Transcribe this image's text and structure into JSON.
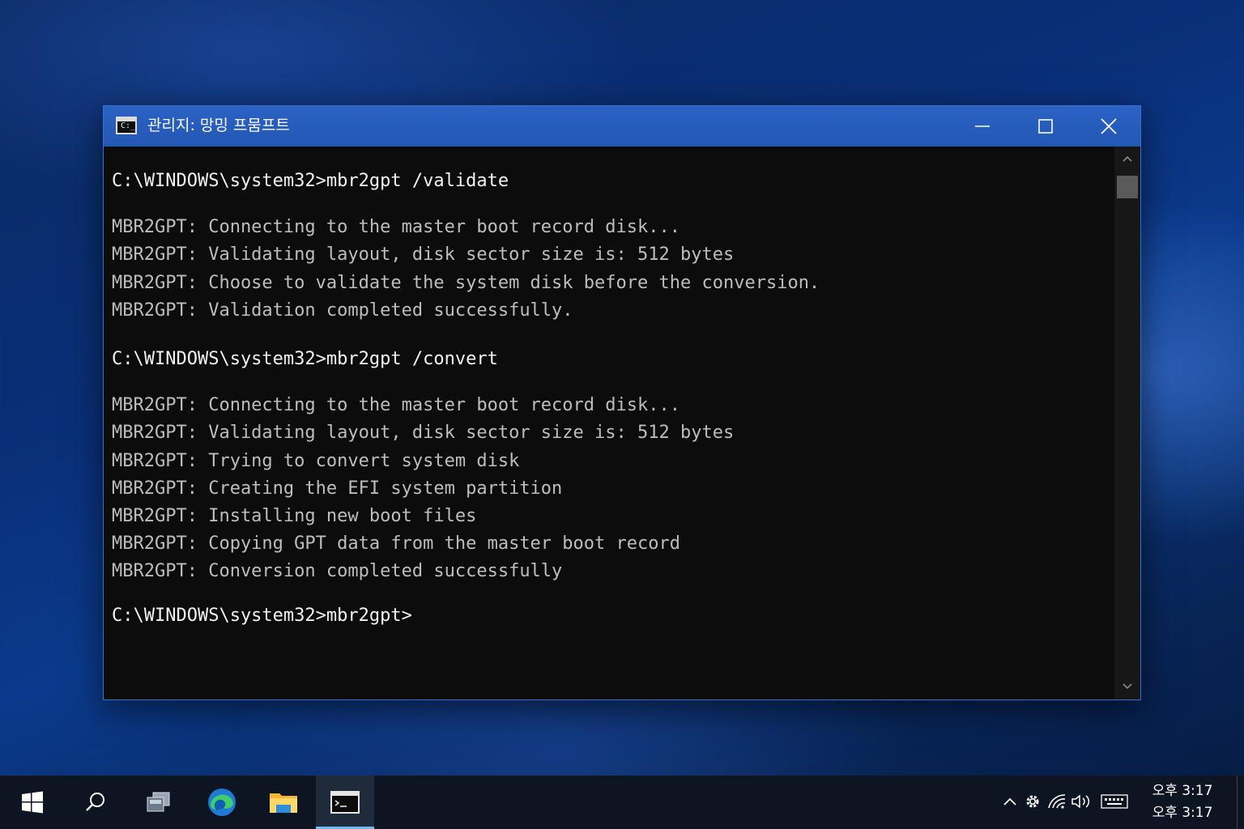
{
  "window": {
    "title": "관리지: 망밍 프뭄프트",
    "icon_name": "console-app-icon",
    "controls": [
      "minimize-icon",
      "maximize-icon",
      "close-icon"
    ]
  },
  "console": {
    "lines": [
      {
        "kind": "cmd",
        "text": "C:\\WINDOWS\\system32>mbr2gpt /validate"
      },
      {
        "kind": "out",
        "text": "MBR2GPT: Connecting to the master boot record disk..."
      },
      {
        "kind": "out",
        "text": "MBR2GPT: Validating layout, disk sector size is: 512 bytes"
      },
      {
        "kind": "out",
        "text": "MBR2GPT: Choose to validate the system disk before the conversion."
      },
      {
        "kind": "out",
        "text": "MBR2GPT: Validation completed successfully."
      },
      {
        "kind": "cmd",
        "text": "C:\\WINDOWS\\system32>mbr2gpt /convert"
      },
      {
        "kind": "out",
        "text": "MBR2GPT: Connecting to the master boot record disk..."
      },
      {
        "kind": "out",
        "text": "MBR2GPT: Validating layout, disk sector size is: 512 bytes"
      },
      {
        "kind": "out",
        "text": "MBR2GPT: Trying to convert system disk"
      },
      {
        "kind": "out",
        "text": "MBR2GPT: Creating the EFI system partition"
      },
      {
        "kind": "out",
        "text": "MBR2GPT: Installing new boot files"
      },
      {
        "kind": "out",
        "text": "MBR2GPT: Copying GPT data from the master boot record"
      },
      {
        "kind": "out",
        "text": "MBR2GPT: Conversion completed successfully"
      },
      {
        "kind": "cmd",
        "text": "C:\\WINDOWS\\system32>mbr2gpt>"
      }
    ]
  },
  "taskbar": {
    "apps": [
      "start-windows-icon",
      "search-icon",
      "task-view-icon",
      "edge-browser-icon",
      "file-explorer-icon",
      "command-prompt-icon"
    ],
    "active_app": "command-prompt-icon",
    "tray": [
      "chevron-up-icon",
      "settings-gear-icon",
      "wifi-icon",
      "speaker-icon",
      "keyboard-icon"
    ],
    "clock_line1": "오후 3:17",
    "clock_line2": "오후 3:17"
  },
  "colors": {
    "titlebar": "#2b62c4",
    "console_bg": "#0c0c0c",
    "console_text": "#cccccc",
    "taskbar_bg": "#0d1522",
    "taskbar_active_indicator": "#76b9ed"
  }
}
